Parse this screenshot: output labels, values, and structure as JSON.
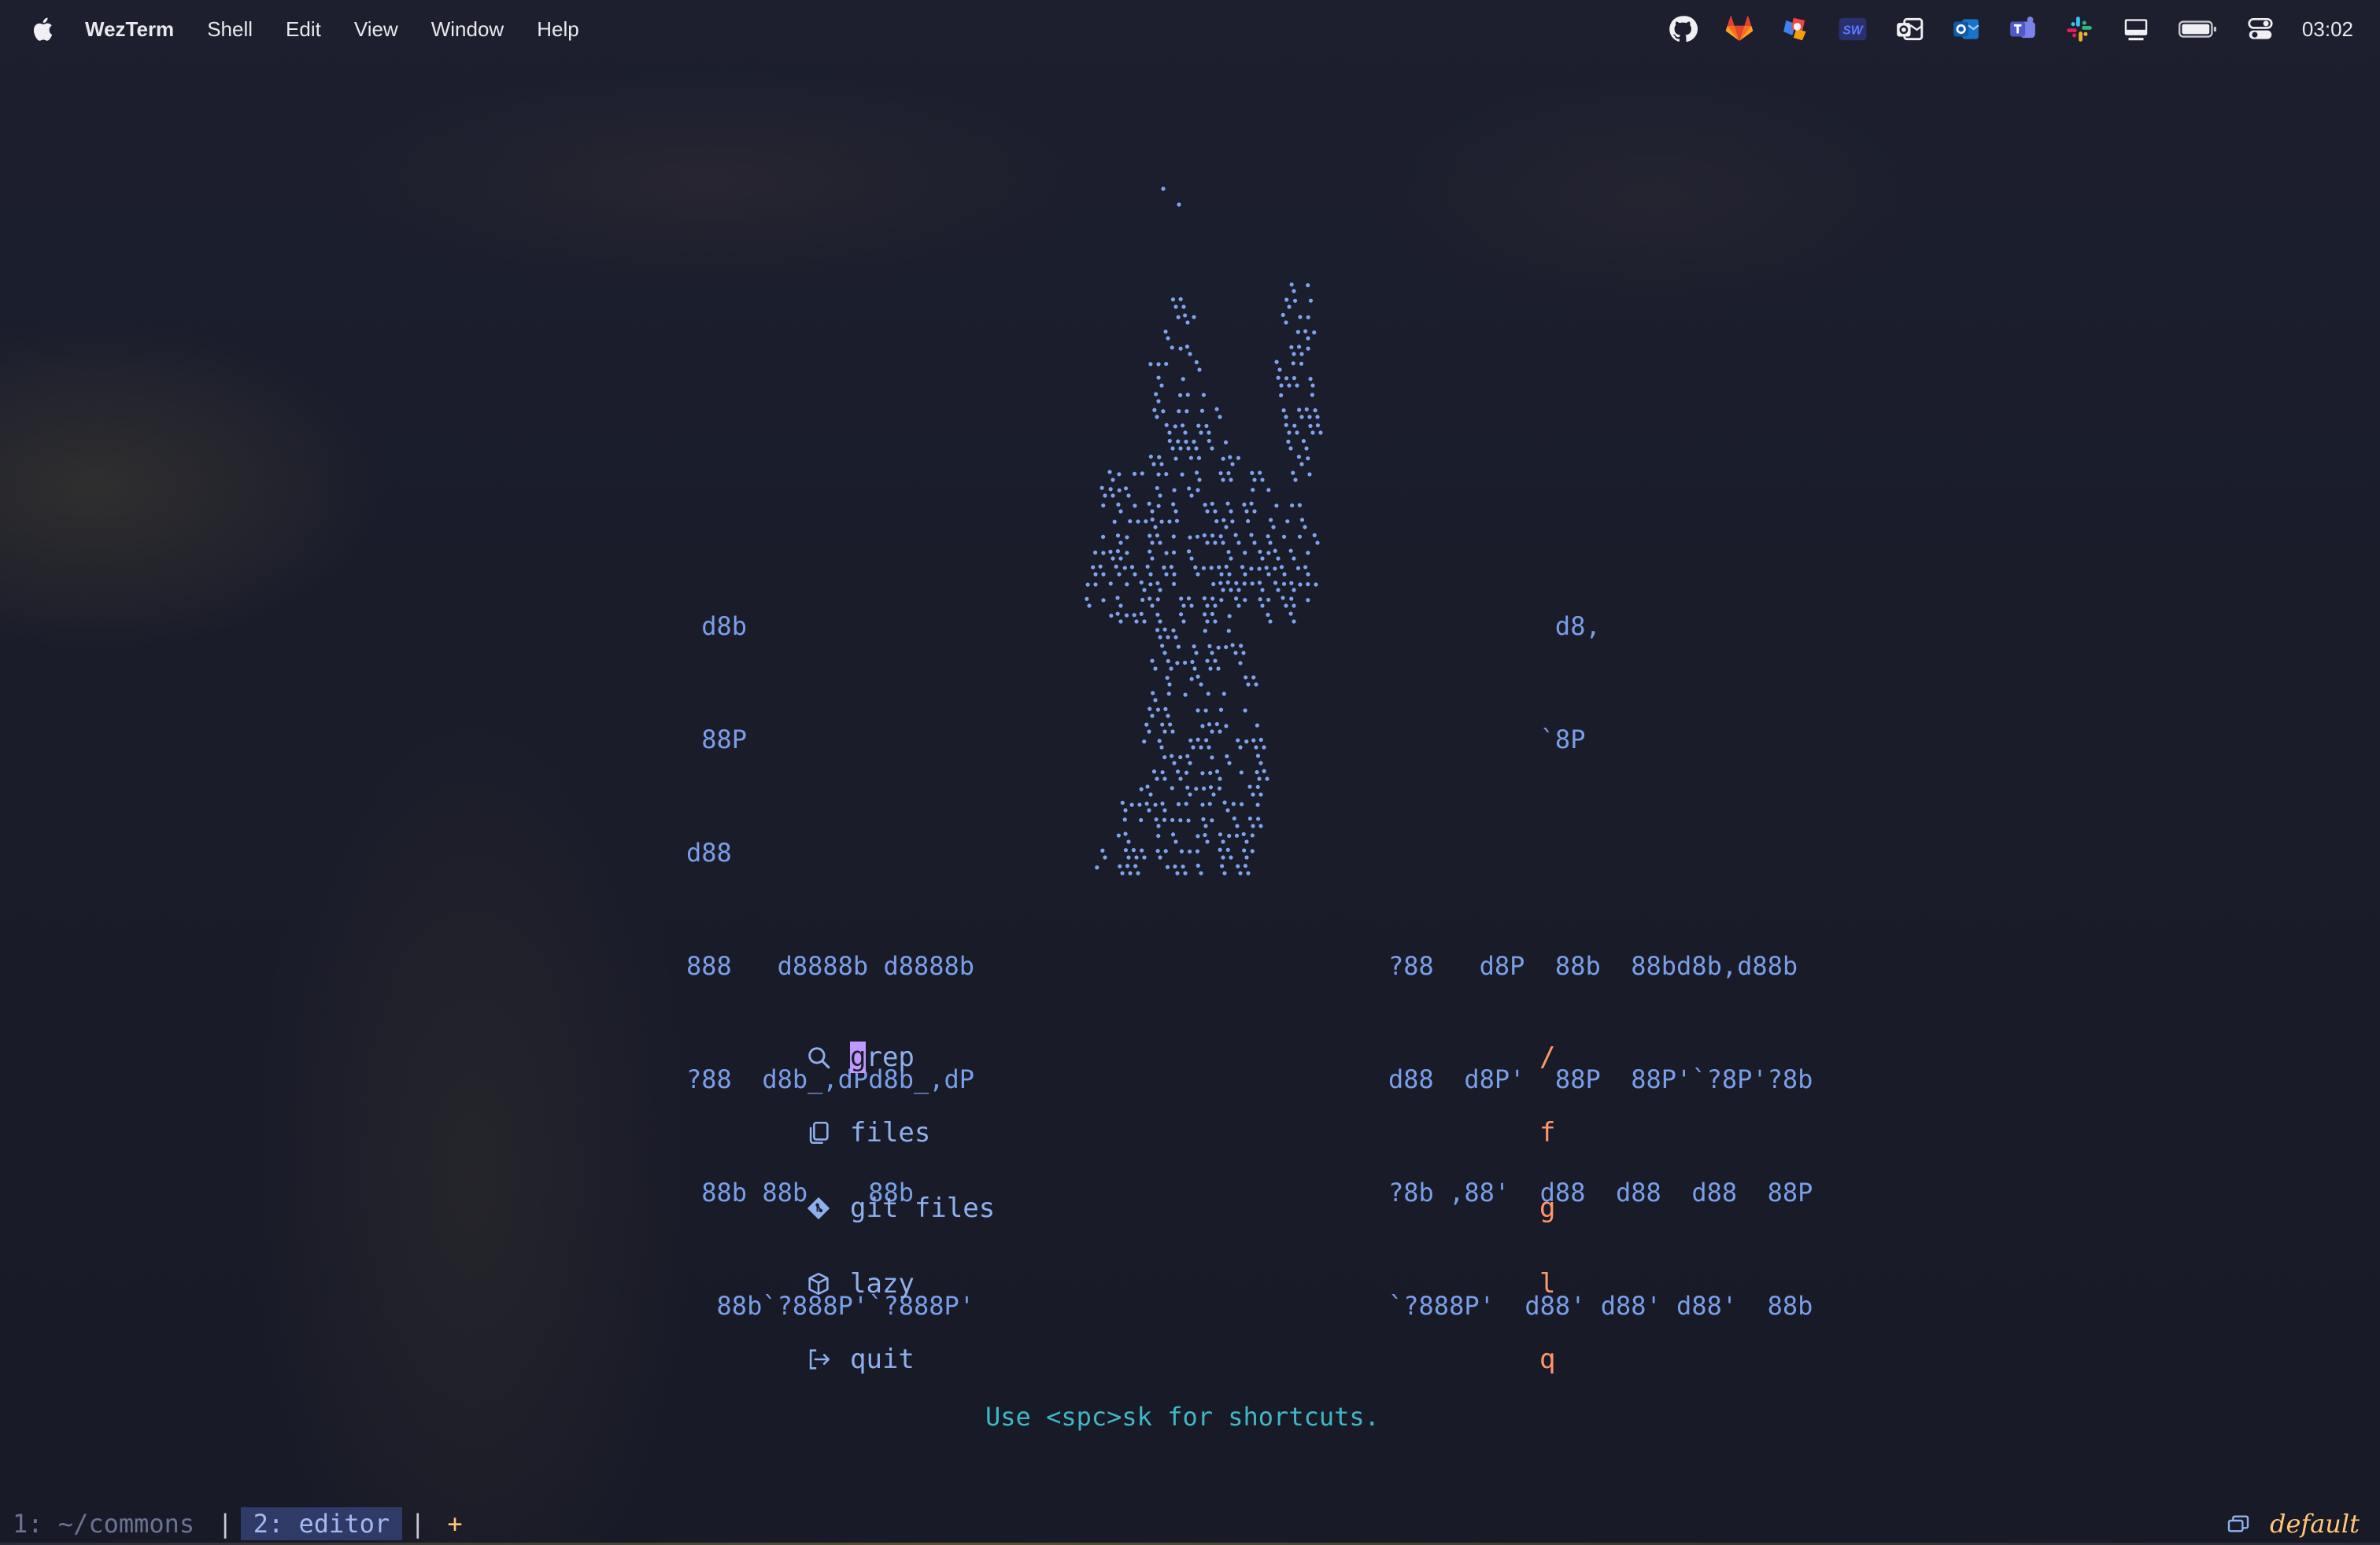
{
  "menubar": {
    "app_name": "WezTerm",
    "items": [
      "Shell",
      "Edit",
      "View",
      "Window",
      "Help"
    ],
    "tray_icons": [
      "github-icon",
      "gitlab-icon",
      "stage-manager-icon",
      "sw-icon",
      "outlook-classic-icon",
      "outlook-icon",
      "teams-icon",
      "slack-icon",
      "display-icon",
      "battery-icon",
      "control-center-icon"
    ],
    "sw_label": "SW",
    "clock": "03:02"
  },
  "banner": {
    "left": [
      " d8b",
      " 88P",
      "d88",
      "888   d8888b d8888b",
      "?88  d8b_,dPd8b_,dP",
      " 88b 88b    88b",
      "  88b`?888P'`?888P'"
    ],
    "right": [
      "           d8,",
      "          `8P",
      "",
      "?88   d8P  88b  88bd8b,d88b",
      "d88  d8P'  88P  88P'`?8P'?8b",
      "?8b ,88'  d88  d88  d88  88P",
      "`?888P'  d88' d88' d88'  88b"
    ]
  },
  "dashboard": {
    "items": [
      {
        "icon": "search-icon",
        "label_rest": "rep",
        "label_first": "g",
        "key": "/"
      },
      {
        "icon": "files-icon",
        "label": "files",
        "key": "f"
      },
      {
        "icon": "git-icon",
        "label": "git files",
        "key": "g"
      },
      {
        "icon": "package-icon",
        "label": "lazy",
        "key": "l"
      },
      {
        "icon": "exit-icon",
        "label": "quit",
        "key": "q"
      }
    ],
    "footer": "Use <spc>sk for shortcuts."
  },
  "tabbar": {
    "tabs": [
      {
        "label": "1: ~/commons ",
        "active": false
      },
      {
        "label": "2: editor",
        "active": true
      }
    ],
    "add_label": "+",
    "workspace": "default"
  },
  "colors": {
    "accent_blue": "#7a9ee8",
    "key_orange": "#ff966c",
    "cursor_purple": "#c099ff",
    "footer_cyan": "#3fb8c6",
    "workspace_yellow": "#ffc777"
  }
}
